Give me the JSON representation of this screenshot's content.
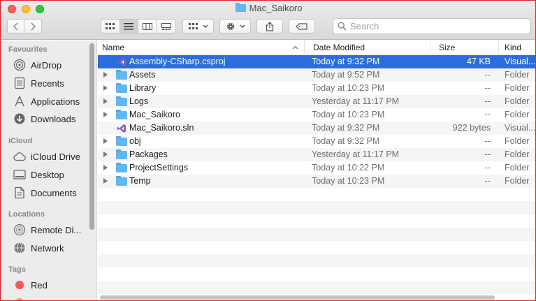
{
  "window": {
    "title": "Mac_Saikoro"
  },
  "toolbar": {
    "back_icon": "chevron-left",
    "forward_icon": "chevron-right",
    "view_modes": [
      "icon-view",
      "list-view",
      "column-view",
      "gallery-view"
    ],
    "active_view": "list-view",
    "group_icon": "group-grid",
    "action_icon": "gear",
    "share_icon": "share",
    "tag_icon": "tag"
  },
  "search": {
    "placeholder": "Search"
  },
  "sidebar": {
    "favourites_heading": "Favourites",
    "favourites": [
      {
        "label": "AirDrop",
        "icon": "airdrop-icon"
      },
      {
        "label": "Recents",
        "icon": "recents-icon"
      },
      {
        "label": "Applications",
        "icon": "applications-icon"
      },
      {
        "label": "Downloads",
        "icon": "downloads-icon"
      }
    ],
    "icloud_heading": "iCloud",
    "icloud": [
      {
        "label": "iCloud Drive",
        "icon": "cloud-icon"
      },
      {
        "label": "Desktop",
        "icon": "desktop-icon"
      },
      {
        "label": "Documents",
        "icon": "documents-icon"
      }
    ],
    "locations_heading": "Locations",
    "locations": [
      {
        "label": "Remote Di...",
        "icon": "disc-icon"
      },
      {
        "label": "Network",
        "icon": "network-icon"
      }
    ],
    "tags_heading": "Tags",
    "tags": [
      {
        "label": "Red",
        "color": "#fc5753"
      },
      {
        "label": "",
        "color": "#fd9a2e"
      }
    ]
  },
  "columns": {
    "name": "Name",
    "date": "Date Modified",
    "size": "Size",
    "kind": "Kind"
  },
  "files": [
    {
      "name": "Assembly-CSharp.csproj",
      "date": "Today at 9:32 PM",
      "size": "47 KB",
      "kind": "Visual...",
      "type": "vs",
      "expandable": false,
      "selected": true
    },
    {
      "name": "Assets",
      "date": "Today at 9:52 PM",
      "size": "--",
      "kind": "Folder",
      "type": "folder",
      "expandable": true,
      "selected": false
    },
    {
      "name": "Library",
      "date": "Today at 10:23 PM",
      "size": "--",
      "kind": "Folder",
      "type": "folder",
      "expandable": true,
      "selected": false
    },
    {
      "name": "Logs",
      "date": "Yesterday at 11:17 PM",
      "size": "--",
      "kind": "Folder",
      "type": "folder",
      "expandable": true,
      "selected": false
    },
    {
      "name": "Mac_Saikoro",
      "date": "Today at 10:23 PM",
      "size": "--",
      "kind": "Folder",
      "type": "folder",
      "expandable": true,
      "selected": false
    },
    {
      "name": "Mac_Saikoro.sln",
      "date": "Today at 9:32 PM",
      "size": "922 bytes",
      "kind": "Visual...",
      "type": "vs",
      "expandable": false,
      "selected": false
    },
    {
      "name": "obj",
      "date": "Today at 9:32 PM",
      "size": "--",
      "kind": "Folder",
      "type": "folder",
      "expandable": true,
      "selected": false
    },
    {
      "name": "Packages",
      "date": "Yesterday at 11:17 PM",
      "size": "--",
      "kind": "Folder",
      "type": "folder",
      "expandable": true,
      "selected": false
    },
    {
      "name": "ProjectSettings",
      "date": "Today at 10:22 PM",
      "size": "--",
      "kind": "Folder",
      "type": "folder",
      "expandable": true,
      "selected": false
    },
    {
      "name": "Temp",
      "date": "Today at 10:23 PM",
      "size": "--",
      "kind": "Folder",
      "type": "folder",
      "expandable": true,
      "selected": false
    }
  ],
  "colors": {
    "selection": "#2a6de0",
    "folder": "#5fb8f1",
    "vs_purple": "#865fc5",
    "window_border": "#d8242a"
  }
}
